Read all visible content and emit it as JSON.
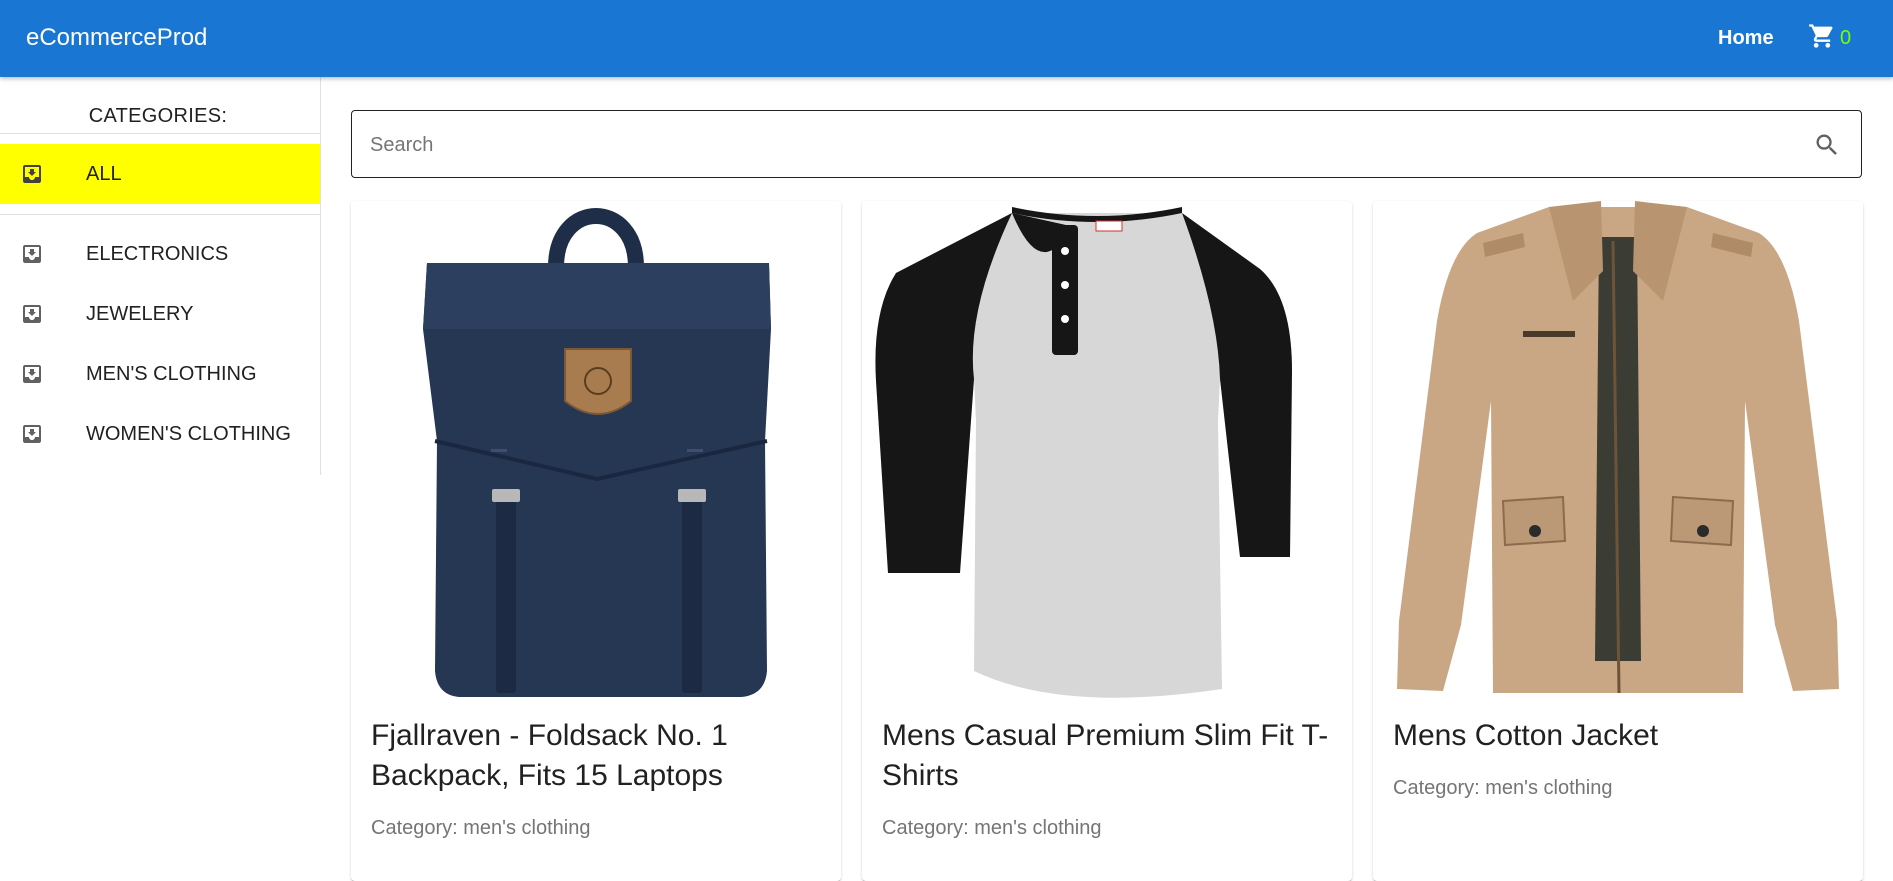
{
  "app": {
    "brand": "eCommerceProd",
    "nav_home": "Home",
    "cart_count": "0",
    "accent": "#1976d2",
    "active_highlight": "#ffff00",
    "cart_count_color": "#76ff03"
  },
  "sidebar": {
    "heading": "CATEGORIES:",
    "icon": "move-to-inbox-icon",
    "items": [
      {
        "label": "ALL",
        "active": true
      },
      {
        "label": "ELECTRONICS"
      },
      {
        "label": "JEWELERY"
      },
      {
        "label": "MEN'S CLOTHING"
      },
      {
        "label": "WOMEN'S CLOTHING"
      }
    ]
  },
  "search": {
    "placeholder": "Search",
    "value": "",
    "icon": "search-icon"
  },
  "products": [
    {
      "title": "Fjallraven - Foldsack No. 1 Backpack, Fits 15 Laptops",
      "category": "Category: men's clothing",
      "image": "navy backpack"
    },
    {
      "title": "Mens Casual Premium Slim Fit T-Shirts",
      "category": "Category: men's clothing",
      "image": "raglan henley t-shirt"
    },
    {
      "title": "Mens Cotton Jacket",
      "category": "Category: men's clothing",
      "image": "khaki jacket"
    }
  ]
}
